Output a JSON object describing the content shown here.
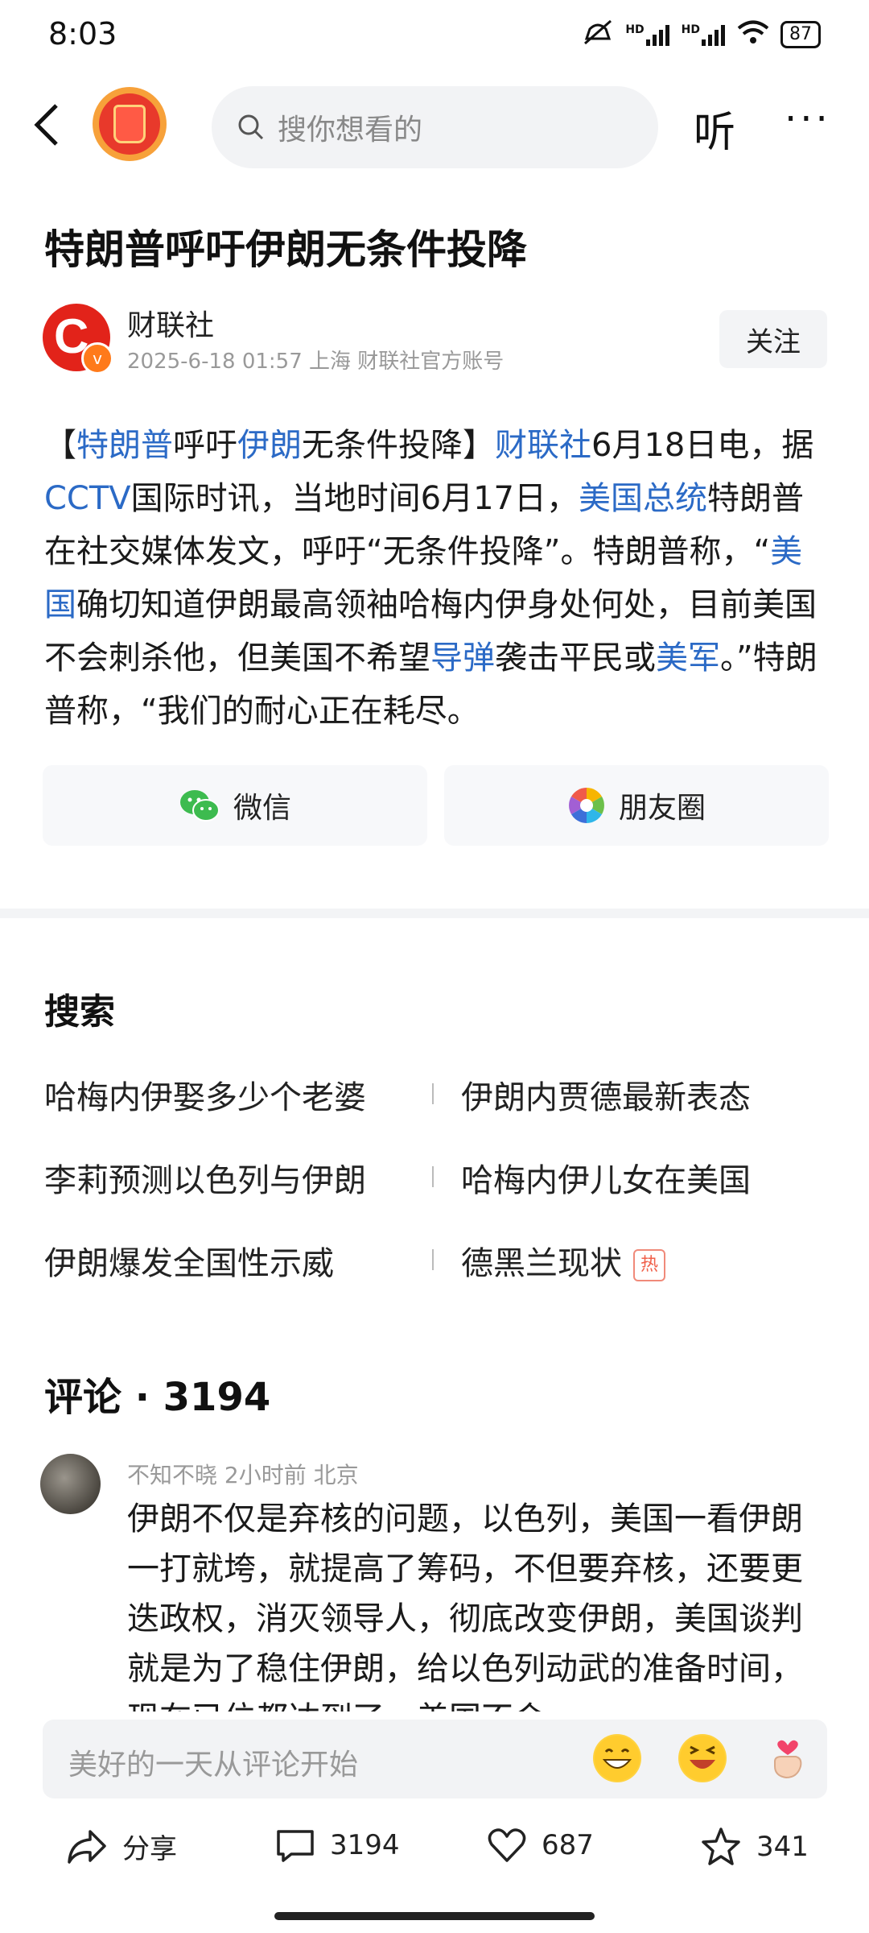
{
  "status_bar": {
    "time": "8:03",
    "signal1": "HD",
    "signal2": "HD",
    "battery": "87"
  },
  "header": {
    "search_placeholder": "搜你想看的",
    "listen_label": "听",
    "more_label": "···"
  },
  "article": {
    "title": "特朗普呼吁伊朗无条件投降",
    "source_name": "财联社",
    "source_meta": "2025-6-18  01:57  上海  财联社官方账号",
    "follow_label": "关注",
    "body_segments": [
      {
        "t": "【",
        "link": false
      },
      {
        "t": "特朗普",
        "link": true
      },
      {
        "t": "呼吁",
        "link": false
      },
      {
        "t": "伊朗",
        "link": true
      },
      {
        "t": "无条件投降】",
        "link": false
      },
      {
        "t": "财联社",
        "link": true
      },
      {
        "t": "6月18日电，据",
        "link": false
      },
      {
        "t": "CCTV",
        "link": true
      },
      {
        "t": "国际时讯，当地时间6月17日，",
        "link": false
      },
      {
        "t": "美国总统",
        "link": true
      },
      {
        "t": "特朗普在社交媒体发文，呼吁“无条件投降”。特朗普称，“",
        "link": false
      },
      {
        "t": "美国",
        "link": true
      },
      {
        "t": "确切知道伊朗最高领袖哈梅内伊身处何处，目前美国不会刺杀他，但美国不希望",
        "link": false
      },
      {
        "t": "导弹",
        "link": true
      },
      {
        "t": "袭击平民或",
        "link": false
      },
      {
        "t": "美军",
        "link": true
      },
      {
        "t": "。”特朗普称，“我们的耐心正在耗尽。",
        "link": false
      }
    ],
    "share_wechat": "微信",
    "share_moments": "朋友圈"
  },
  "search_section": {
    "title": "搜索",
    "items": [
      {
        "text": "哈梅内伊娶多少个老婆",
        "hot": false
      },
      {
        "text": "伊朗内贾德最新表态",
        "hot": false
      },
      {
        "text": "李莉预测以色列与伊朗",
        "hot": false
      },
      {
        "text": "哈梅内伊儿女在美国",
        "hot": false
      },
      {
        "text": "伊朗爆发全国性示威",
        "hot": false
      },
      {
        "text": "德黑兰现状",
        "hot": true
      }
    ],
    "hot_label": "热"
  },
  "comments": {
    "title": "评论 · 3194",
    "first": {
      "meta": "不知不晓  2小时前  北京",
      "text": "伊朗不仅是弃核的问题，以色列，美国一看伊朗一打就垮，就提高了筹码，不但要弃核，还要更迭政权，消灭领导人，彻底改变伊朗，美国谈判就是为了稳住伊朗，给以色列动武的准备时间，现在已位都达到了，美国不会"
    }
  },
  "input_bar": {
    "placeholder": "美好的一天从评论开始",
    "emoji": [
      "grin-emoji",
      "laugh-emoji",
      "heart-hand-emoji"
    ]
  },
  "bottom_bar": {
    "share_label": "分享",
    "comments_count": "3194",
    "likes_count": "687",
    "favorites_count": "341"
  }
}
